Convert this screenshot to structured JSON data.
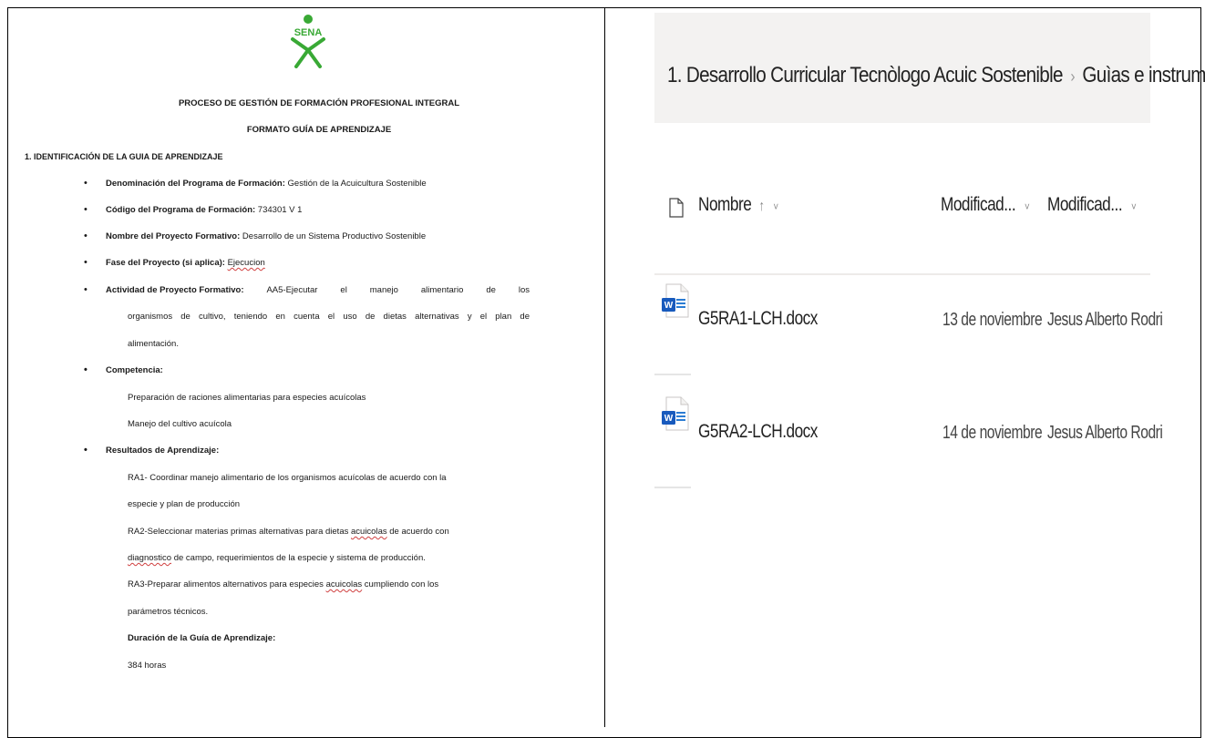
{
  "document": {
    "logo_text": "SENA",
    "title_line1": "PROCESO DE GESTIÓN DE FORMACIÓN PROFESIONAL INTEGRAL",
    "title_line2": "FORMATO GUÍA DE APRENDIZAJE",
    "section1": "1. IDENTIFICACIÓN DE LA GUIA DE APRENDIZAJE",
    "fields": {
      "programa_label": "Denominación del Programa de Formación:",
      "programa_value": " Gestión de la Acuicultura Sostenible",
      "codigo_label": "Código del Programa de Formación:",
      "codigo_value": " 734301 V 1",
      "proyecto_label": "Nombre del Proyecto Formativo:",
      "proyecto_value": " Desarrollo de un Sistema Productivo Sostenible",
      "fase_label": "Fase del Proyecto (si aplica):",
      "fase_value": "Ejecucion",
      "actividad_label": "Actividad de Proyecto Formativo:",
      "actividad_line1_words": [
        "AA5-Ejecutar",
        "el",
        "manejo",
        "alimentario",
        "de",
        "los"
      ],
      "actividad_line2_words": [
        "organismos",
        "de",
        "cultivo,",
        "teniendo",
        "en",
        "cuenta",
        "el",
        "uso",
        "de",
        "dietas",
        "alternativas",
        "y",
        "el",
        "plan",
        "de"
      ],
      "actividad_line3": "alimentación.",
      "competencia_label": "Competencia:",
      "competencia_1": "Preparación de raciones alimentarias para especies acuícolas",
      "competencia_2": "Manejo del cultivo acuícola",
      "resultados_label": "Resultados de Aprendizaje:",
      "ra1_a": "RA1- Coordinar manejo alimentario de los organismos acuícolas de acuerdo con la",
      "ra1_b": "especie y plan de producción",
      "ra2_a_pre": "RA2-Seleccionar materias primas alternativas para dietas ",
      "ra2_a_sq": "acuicolas",
      "ra2_a_post": " de acuerdo con",
      "ra2_b_sq": "diagnostico",
      "ra2_b_post": " de campo, requerimientos de la especie y sistema de producción.",
      "ra3_a_pre": "RA3-Preparar alimentos alternativos para especies ",
      "ra3_a_sq": "acuicolas",
      "ra3_a_post": " cumpliendo con los",
      "ra3_b": "parámetros técnicos.",
      "duracion_label": "Duración de la Guía de Aprendizaje:",
      "duracion_value": "384 horas"
    }
  },
  "sharepoint": {
    "breadcrumb": {
      "item1": "1. Desarrollo Curricular Tecnòlogo Acuic Sostenible",
      "separator": "›",
      "item2": "Guìas e instrumento"
    },
    "columns": {
      "name": "Nombre",
      "sort_arrow": "↑",
      "chevron": "˅",
      "modified": "Modificad...",
      "modified_by": "Modificad..."
    },
    "files": [
      {
        "name": "G5RA1-LCH.docx",
        "modified": "13 de noviembre",
        "modified_by": "Jesus Alberto Rodri",
        "icon": "word-doc-icon"
      },
      {
        "name": "G5RA2-LCH.docx",
        "modified": "14 de noviembre",
        "modified_by": "Jesus Alberto Rodri",
        "icon": "word-doc-icon"
      }
    ]
  },
  "colors": {
    "sena_green": "#39a935",
    "word_blue": "#185abd",
    "crumb_bg": "#f3f2f1"
  }
}
